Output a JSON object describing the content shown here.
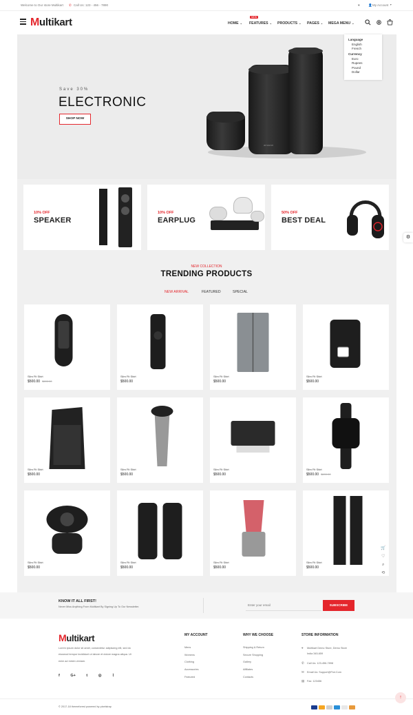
{
  "topbar": {
    "welcome": "Welcome to Our store Multikart",
    "phone": "Call Us: 123 - 456 - 7890",
    "account": "My Account"
  },
  "header": {
    "logo_mark": "M",
    "logo_rest": "ultikart",
    "nav": [
      {
        "label": "HOME"
      },
      {
        "label": "FEATURES",
        "badge": "NEW"
      },
      {
        "label": "PRODUCTS"
      },
      {
        "label": "PAGES"
      },
      {
        "label": "MEGA MENU"
      }
    ]
  },
  "dropdown": {
    "language_title": "Language",
    "languages": [
      "English",
      "French"
    ],
    "currency_title": "Currency",
    "currencies": [
      "Euro",
      "Rupees",
      "Pound",
      "Dollar"
    ]
  },
  "hero": {
    "subtitle": "Save 30%",
    "title": "ELECTRONIC",
    "button": "SHOP NOW",
    "brand": "amazon"
  },
  "categories": [
    {
      "offer": "10% OFF",
      "name": "SPEAKER"
    },
    {
      "offer": "10% OFF",
      "name": "EARPLUG"
    },
    {
      "offer": "50% OFF",
      "name": "BEST DEAL"
    }
  ],
  "trending": {
    "kicker": "NEW COLLECTION",
    "title": "TRENDING PRODUCTS",
    "tabs": [
      "NEW ARRIVAL",
      "FEATURED",
      "SPECIAL"
    ]
  },
  "products": [
    {
      "name": "Slim Fit Shirt",
      "price": "$500.00",
      "old": "$600.00",
      "icon": "smart-remote"
    },
    {
      "name": "Slim Fit Shirt",
      "price": "$500.00",
      "old": "",
      "icon": "tv-remote"
    },
    {
      "name": "Slim Fit Shirt",
      "price": "$500.00",
      "old": "",
      "icon": "refrigerator"
    },
    {
      "name": "Slim Fit Shirt",
      "price": "$500.00",
      "old": "",
      "icon": "coffee-maker"
    },
    {
      "name": "Slim Fit Shirt",
      "price": "$500.00",
      "old": "",
      "icon": "pa-speaker"
    },
    {
      "name": "Slim Fit Shirt",
      "price": "$500.00",
      "old": "",
      "icon": "shaver"
    },
    {
      "name": "Slim Fit Shirt",
      "price": "$500.00",
      "old": "",
      "icon": "printer"
    },
    {
      "name": "Slim Fit Shirt",
      "price": "$500.00",
      "old": "$600.00",
      "icon": "smartwatch"
    },
    {
      "name": "Slim Fit Shirt",
      "price": "$500.00",
      "old": "",
      "icon": "webcam"
    },
    {
      "name": "Slim Fit Shirt",
      "price": "$500.00",
      "old": "",
      "icon": "desk-speakers"
    },
    {
      "name": "Slim Fit Shirt",
      "price": "$500.00",
      "old": "",
      "icon": "blender"
    },
    {
      "name": "Slim Fit Shirt",
      "price": "$500.00",
      "old": "",
      "icon": "tower-speakers"
    }
  ],
  "newsletter": {
    "title": "KNOW IT ALL FIRST!",
    "text": "Never Miss Anything From Multikart By Signing Up To Our Newsletter.",
    "placeholder": "Enter your email",
    "button": "SUBSCRIBE"
  },
  "footer": {
    "about_line1": "Lorem ipsum dolor sit amet, consectetur adipiscing elit, sed do",
    "about_line2": "eiusmod tempor incididunt ut labore et dolore magna aliqua. Ut",
    "about_line3": "enim ad minim veniam.",
    "col1_title": "MY ACCOUNT",
    "col1": [
      "Mens",
      "Womens",
      "Clothing",
      "Accessories",
      "Featured"
    ],
    "col2_title": "WHY WE CHOOSE",
    "col2": [
      "Shipping & Return",
      "Secure Shopping",
      "Gallery",
      "Affiliates",
      "Contacts"
    ],
    "col3_title": "STORE INFORMATION",
    "store_address1": "Multikart Demo Store, Demo Store",
    "store_address2": "India 345-659",
    "store_call": "Call Us: 123-456-7898",
    "store_email": "Email Us: Support@Fiot.Com",
    "store_fax": "Fax: 123456",
    "copyright": "© 2017-18 themeforest powered by pixelstrap"
  },
  "colors": {
    "accent": "#e4262c",
    "hero_bg": "#ececec",
    "section_bg": "#f0f0f0"
  }
}
